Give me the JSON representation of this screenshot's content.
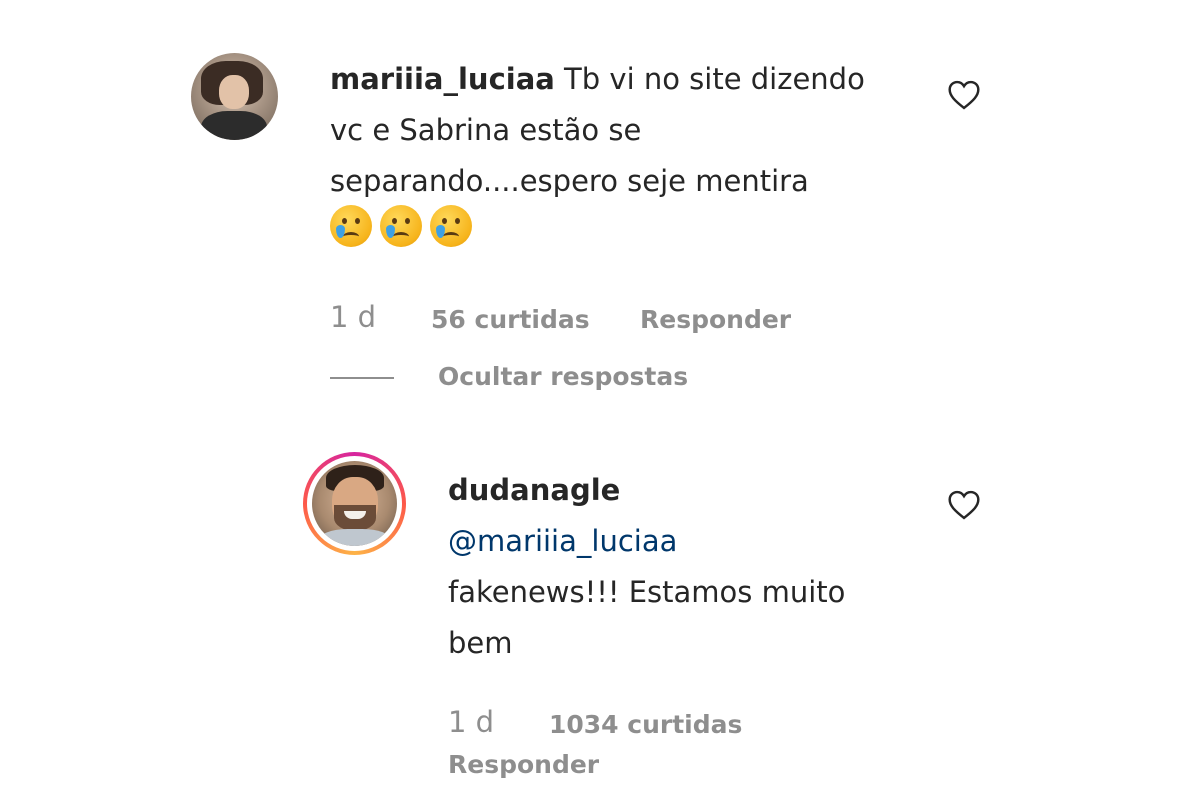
{
  "comment": {
    "username": "mariiia_luciaa",
    "text": " Tb vi no site dizendo vc e Sabrina estão se separando....espero seje mentira",
    "emojis": [
      "crying-face-icon",
      "crying-face-icon",
      "crying-face-icon"
    ],
    "time": "1 d",
    "likes": "56 curtidas",
    "reply_label": "Responder",
    "hide_replies_label": "Ocultar respostas"
  },
  "reply": {
    "username": "dudanagle",
    "mention": "@mariiia_luciaa",
    "text": "fakenews!!! Estamos muito bem",
    "time": "1 d",
    "likes": "1034 curtidas",
    "reply_label": "Responder"
  },
  "colors": {
    "text": "#262626",
    "muted": "#8e8e8e",
    "mention": "#00376b"
  }
}
